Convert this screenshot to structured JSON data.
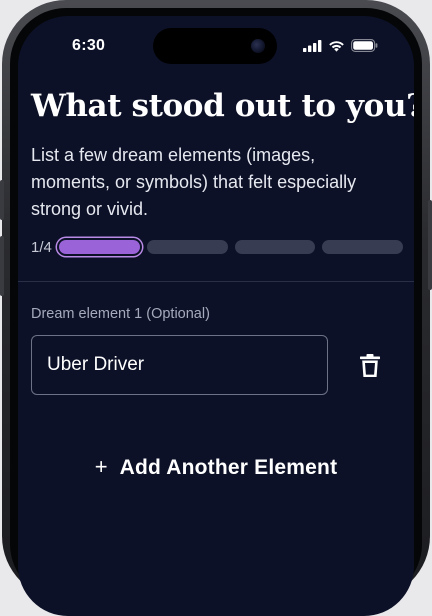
{
  "status_bar": {
    "time": "6:30",
    "icons": [
      "cellular-signal-icon",
      "wifi-icon",
      "battery-icon"
    ]
  },
  "header": {
    "title": "What stood out to you?",
    "subtitle": "List a few dream elements (images, moments, or symbols) that felt especially strong or vivid."
  },
  "progress": {
    "text": "1/4",
    "current": 1,
    "total": 4
  },
  "elements": [
    {
      "label": "Dream element 1 (Optional)",
      "value": "Uber Driver",
      "delete_icon": "trash-icon"
    }
  ],
  "add_button": {
    "icon": "+",
    "label": "Add Another Element"
  },
  "colors": {
    "background": "#0c1127",
    "accent": "#9a63d8",
    "inactive_segment": "#383c52",
    "field_border": "#6e7286"
  }
}
